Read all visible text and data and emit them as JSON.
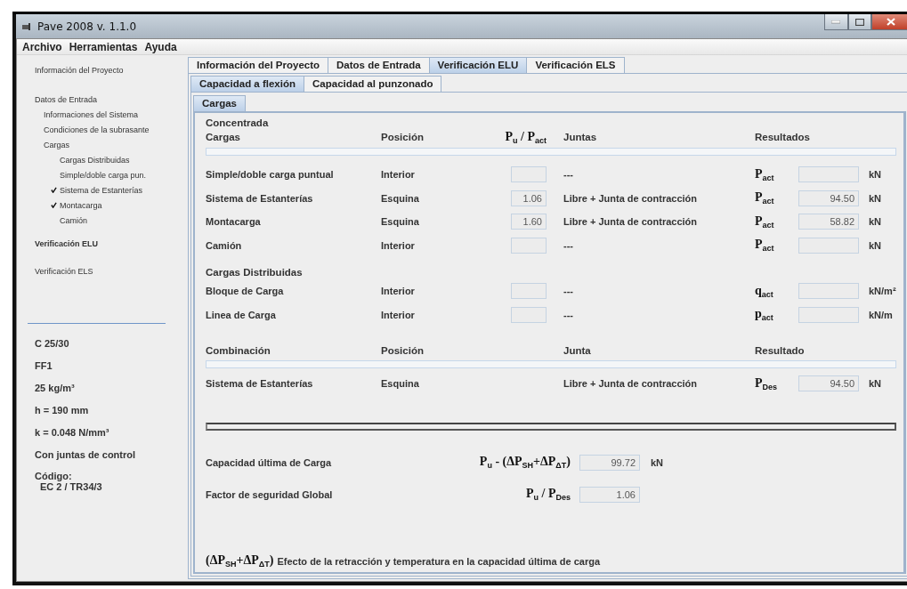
{
  "window": {
    "title": "Pave 2008  v. 1.1.0"
  },
  "menu": [
    "Archivo",
    "Herramientas",
    "Ayuda"
  ],
  "sidebar": {
    "nav": [
      {
        "label": "Información del Proyecto",
        "selected": false
      },
      {
        "label": "Datos de Entrada",
        "selected": false,
        "children": [
          {
            "label": "Informaciones del Sistema",
            "selected": false
          },
          {
            "label": "Condiciones de la subrasante",
            "selected": false
          },
          {
            "label": "Cargas",
            "selected": false,
            "children": [
              {
                "label": "Cargas Distribuidas",
                "selected": false,
                "checked": false
              },
              {
                "label": "Simple/doble carga pun.",
                "selected": false,
                "checked": false
              },
              {
                "label": "Sistema de Estanterías",
                "selected": false,
                "checked": true
              },
              {
                "label": "Montacarga",
                "selected": false,
                "checked": true
              },
              {
                "label": "Camión",
                "selected": false,
                "checked": false
              }
            ]
          }
        ]
      },
      {
        "label": "Verificación ELU",
        "selected": true
      },
      {
        "label": "Verificación ELS",
        "selected": false
      }
    ],
    "summary": [
      "C 25/30",
      "FF1",
      "25 kg/m³",
      "h = 190 mm",
      "k = 0.048 N/mm³",
      "Con juntas de control"
    ],
    "code": {
      "label": "Código:",
      "value": "EC 2 / TR34/3"
    }
  },
  "tabs": [
    {
      "label": "Información del Proyecto",
      "selected": false
    },
    {
      "label": "Datos de Entrada",
      "selected": false
    },
    {
      "label": "Verificación ELU",
      "selected": true
    },
    {
      "label": "Verificación ELS",
      "selected": false
    }
  ],
  "subtabs": [
    {
      "label": "Capacidad a flexión",
      "selected": true
    },
    {
      "label": "Capacidad al punzonado",
      "selected": false
    }
  ],
  "inner_tabs": [
    {
      "label": "Cargas",
      "selected": true
    }
  ],
  "concentrated": {
    "title": "Concentrada",
    "headers": [
      "Cargas",
      "Posición",
      "P$_{u}$ / P$_{act}$",
      "Juntas",
      "Resultados"
    ],
    "rows": [
      {
        "load": "Simple/doble carga puntual",
        "position": "Interior",
        "joint": "---",
        "symbol": "P$_{act}$",
        "unit": "kN"
      },
      {
        "load": "Sistema de Estanterías",
        "position": "Esquina",
        "ratio": "1.06",
        "joint": "Libre + Junta de contracción",
        "symbol": "P$_{act}$",
        "result": "94.50",
        "unit": "kN"
      },
      {
        "load": "Montacarga",
        "position": "Esquina",
        "ratio": "1.60",
        "joint": "Libre + Junta de contracción",
        "symbol": "P$_{act}$",
        "result": "58.82",
        "unit": "kN"
      },
      {
        "load": "Camión",
        "position": "Interior",
        "joint": "---",
        "symbol": "P$_{act}$",
        "unit": "kN"
      }
    ]
  },
  "distributed": {
    "title": "Cargas Distribuidas",
    "rows": [
      {
        "load": "Bloque de Carga",
        "position": "Interior",
        "joint": "---",
        "symbol": "q$_{act}$",
        "unit": "kN/m²"
      },
      {
        "load": "Linea de Carga",
        "position": "Interior",
        "joint": "---",
        "symbol": "p$_{act}$",
        "unit": "kN/m"
      }
    ]
  },
  "combination": {
    "headers": [
      "Combinación",
      "Posición",
      "Junta",
      "Resultado"
    ],
    "rows": [
      {
        "load": "Sistema de Estanterías",
        "position": "Esquina",
        "joint": "Libre + Junta de contracción",
        "symbol": "P$_{Des}$",
        "result": "94.50",
        "unit": "kN"
      }
    ]
  },
  "results": [
    {
      "label": "Capacidad última de Carga",
      "formula": "P$_{u}$ - (ΔP$_{SH}$+ΔP$_{ΔT}$)",
      "value": "99.72",
      "unit": "kN"
    },
    {
      "label": "Factor de seguridad Global",
      "formula": "P$_{u}$ / P$_{Des}$",
      "value": "1.06"
    }
  ],
  "footnote": {
    "formula": "(ΔP$_{SH}$+ΔP$_{ΔT}$)",
    "text": "Efecto de la retracción y temperatura en la capacidad última de carga"
  }
}
